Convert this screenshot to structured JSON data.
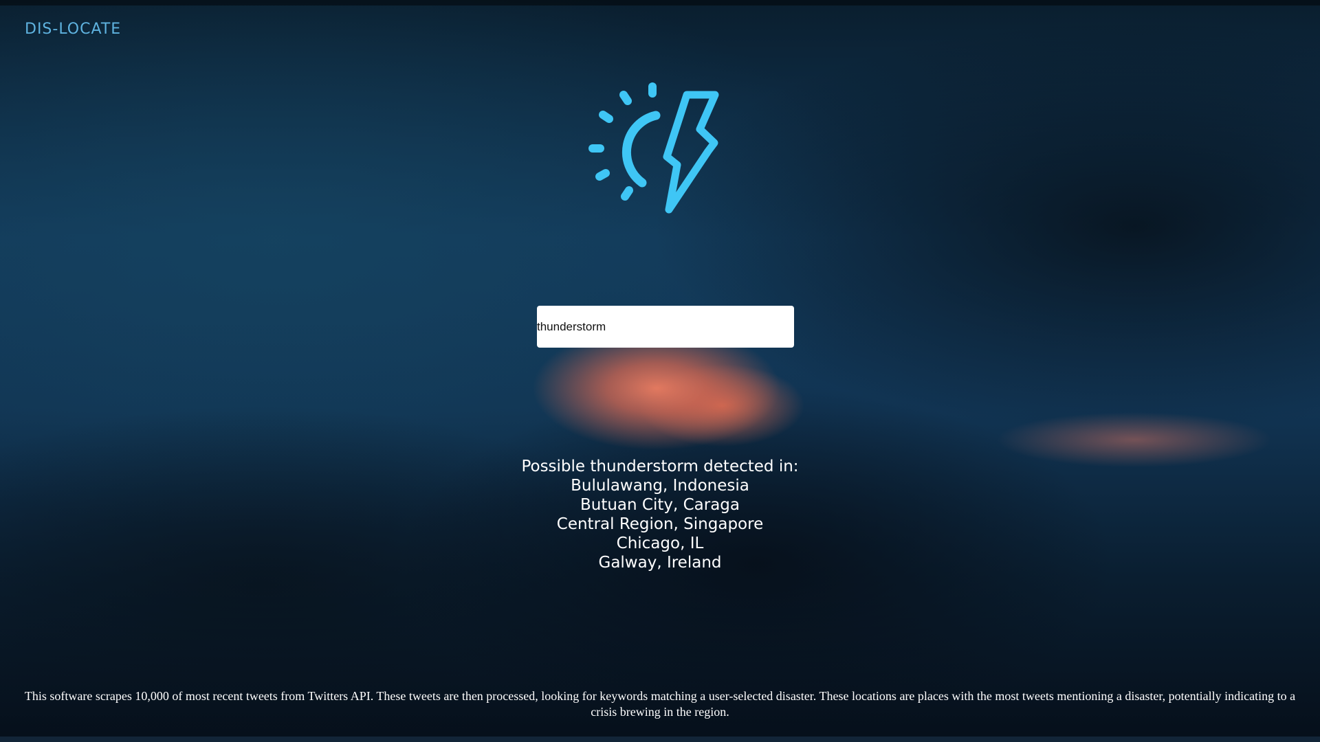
{
  "app": {
    "brand": "DIS-LOCATE"
  },
  "logo": {
    "icon": "sun-lightning-icon",
    "color": "#3fc6f5"
  },
  "search": {
    "value": "thunderstorm",
    "placeholder": ""
  },
  "results": {
    "heading": "Possible thunderstorm detected in:",
    "locations": [
      "Bululawang, Indonesia",
      "Butuan City, Caraga",
      "Central Region, Singapore",
      "Chicago, IL",
      "Galway, Ireland"
    ]
  },
  "footer": {
    "description": "This software scrapes 10,000 of most recent tweets from Twitters API. These tweets are then processed, looking for keywords matching a user-selected disaster. These locations are places with the most tweets mentioning a disaster, potentially indicating to a crisis brewing in the region."
  },
  "colors": {
    "accent": "#3fc6f5",
    "brand_text": "#5fb3e0",
    "text": "#ffffff"
  }
}
